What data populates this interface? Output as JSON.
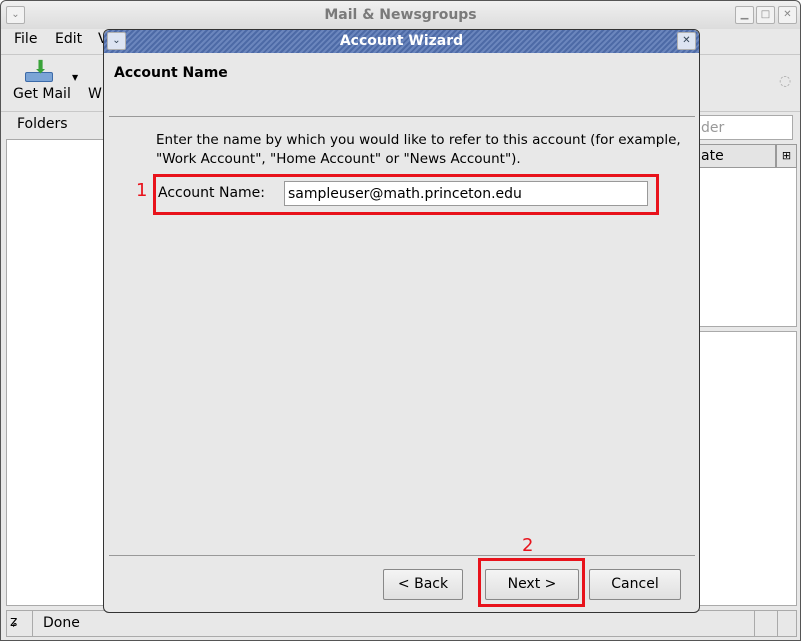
{
  "main_window": {
    "title": "Mail & Newsgroups",
    "menu": [
      "File",
      "Edit",
      "V"
    ],
    "toolbar": {
      "get_mail": "Get Mail",
      "write": "W"
    },
    "folders_header": "Folders",
    "search_placeholder": "der",
    "column_header": "ate",
    "status": "Done"
  },
  "dialog": {
    "title": "Account Wizard",
    "heading": "Account Name",
    "description_line1": "Enter the name by which you would like to refer to this account (for example,",
    "description_line2": "\"Work Account\", \"Home Account\" or \"News Account\").",
    "field_label": "Account Name:",
    "field_value": "sampleuser@math.princeton.edu",
    "buttons": {
      "back": "< Back",
      "next": "Next >",
      "cancel": "Cancel"
    }
  },
  "annotations": {
    "step1": "1",
    "step2": "2",
    "color": "#e8121b"
  }
}
